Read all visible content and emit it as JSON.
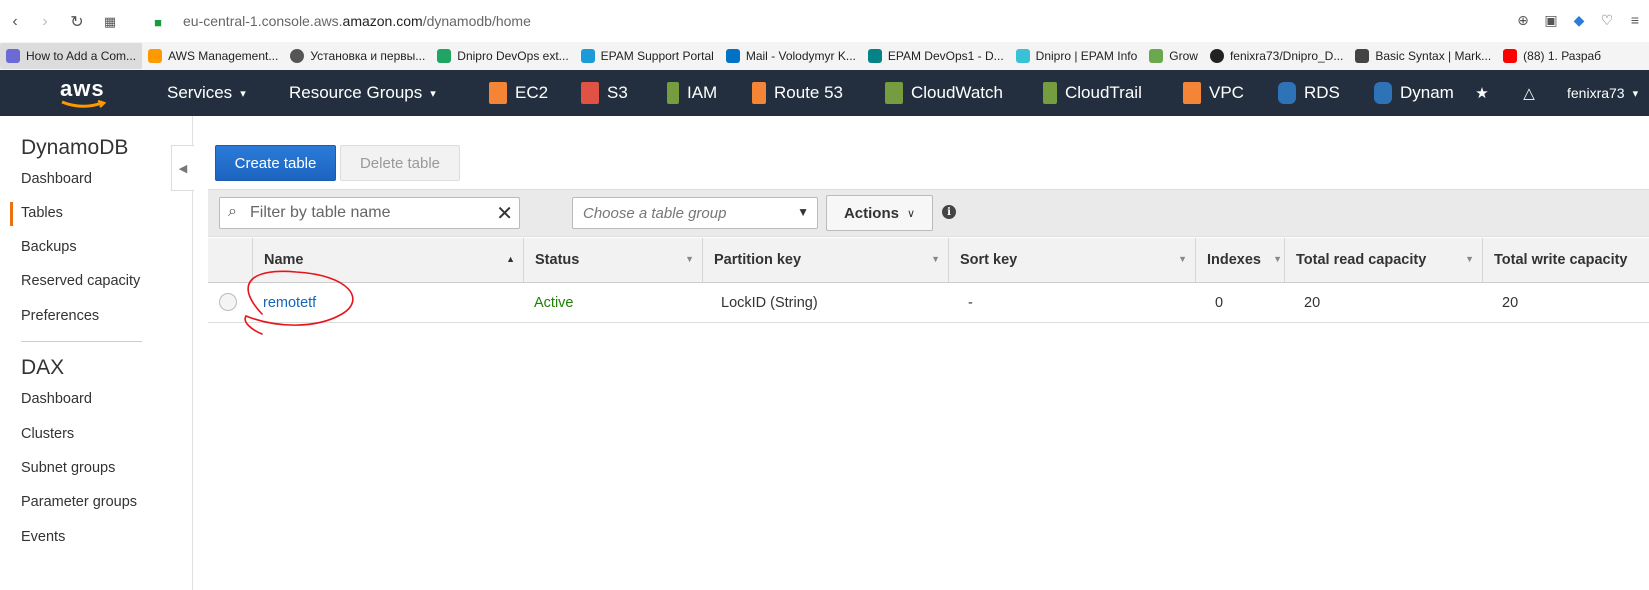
{
  "browser": {
    "url_prefix": "eu-central-1.console.aws.",
    "url_domain": "amazon.com",
    "url_path": "/dynamodb/home",
    "bookmarks": [
      {
        "label": "How to Add a Com...",
        "color": "#6b6bd6"
      },
      {
        "label": "AWS Management...",
        "color": "#ff9900"
      },
      {
        "label": "Установка и первы...",
        "color": "#555555"
      },
      {
        "label": "Dnipro DevOps ext...",
        "color": "#1fa463"
      },
      {
        "label": "EPAM Support Portal",
        "color": "#1a9bd7"
      },
      {
        "label": "Mail - Volodymyr K...",
        "color": "#0072c6"
      },
      {
        "label": "EPAM DevOps1 - D...",
        "color": "#038387"
      },
      {
        "label": "Dnipro | EPAM Info",
        "color": "#39c2d7"
      },
      {
        "label": "Grow",
        "color": "#6aa84f"
      },
      {
        "label": "fenixra73/Dnipro_D...",
        "color": "#222222"
      },
      {
        "label": "Basic Syntax | Mark...",
        "color": "#444444"
      },
      {
        "label": "(88) 1. Разраб",
        "color": "#ff0000"
      }
    ]
  },
  "aws_nav": {
    "logo": "aws",
    "services_label": "Services",
    "resource_groups_label": "Resource Groups",
    "shortcuts": [
      {
        "label": "EC2",
        "color": "#f58536"
      },
      {
        "label": "S3",
        "color": "#e05243"
      },
      {
        "label": "IAM",
        "color": "#759c3e"
      },
      {
        "label": "Route 53",
        "color": "#f58536"
      },
      {
        "label": "CloudWatch",
        "color": "#759c3e"
      },
      {
        "label": "CloudTrail",
        "color": "#759c3e"
      },
      {
        "label": "VPC",
        "color": "#f58536"
      },
      {
        "label": "RDS",
        "color": "#2e73b8"
      },
      {
        "label": "Dynam",
        "color": "#2e73b8"
      }
    ],
    "user": "fenixra73"
  },
  "sidebar": {
    "dynamodb_title": "DynamoDB",
    "dynamodb_items": [
      "Dashboard",
      "Tables",
      "Backups",
      "Reserved capacity",
      "Preferences"
    ],
    "active_item": "Tables",
    "dax_title": "DAX",
    "dax_items": [
      "Dashboard",
      "Clusters",
      "Subnet groups",
      "Parameter groups",
      "Events"
    ]
  },
  "toolbar": {
    "create_label": "Create table",
    "delete_label": "Delete table"
  },
  "filter": {
    "search_placeholder": "Filter by table name",
    "group_placeholder": "Choose a table group",
    "actions_label": "Actions"
  },
  "table": {
    "columns": [
      "Name",
      "Status",
      "Partition key",
      "Sort key",
      "Indexes",
      "Total read capacity",
      "Total write capacity"
    ],
    "rows": [
      {
        "name": "remotetf",
        "status": "Active",
        "partition_key": "LockID (String)",
        "sort_key": "-",
        "indexes": "0",
        "read_capacity": "20",
        "write_capacity": "20"
      }
    ]
  },
  "colors": {
    "aws_nav_bg": "#232f3e",
    "primary_button": "#1c64c0",
    "link": "#1166bb",
    "status_active": "#1d8102",
    "sidebar_active": "#ec7211",
    "annotation": "#e8141b"
  }
}
